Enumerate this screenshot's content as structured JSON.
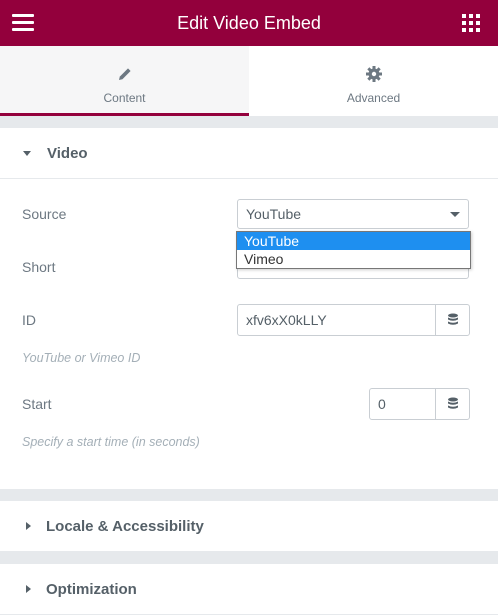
{
  "header": {
    "title": "Edit Video Embed",
    "menu_icon": "hamburger-icon",
    "apps_icon": "grid-icon"
  },
  "tabs": [
    {
      "label": "Content",
      "icon": "pencil-icon",
      "active": true
    },
    {
      "label": "Advanced",
      "icon": "gear-icon",
      "active": false
    }
  ],
  "video_section": {
    "title": "Video",
    "source": {
      "label": "Source",
      "value": "YouTube",
      "options": [
        "YouTube",
        "Vimeo"
      ],
      "highlighted": "YouTube"
    },
    "short": {
      "label": "Short"
    },
    "id": {
      "label": "ID",
      "value": "xfv6xX0kLLY",
      "hint": "YouTube or Vimeo ID"
    },
    "start": {
      "label": "Start",
      "value": "0",
      "hint": "Specify a start time (in seconds)"
    }
  },
  "collapsed_sections": [
    {
      "title": "Locale & Accessibility"
    },
    {
      "title": "Optimization"
    }
  ],
  "colors": {
    "brand": "#93003c",
    "highlight": "#1e8ff0"
  }
}
